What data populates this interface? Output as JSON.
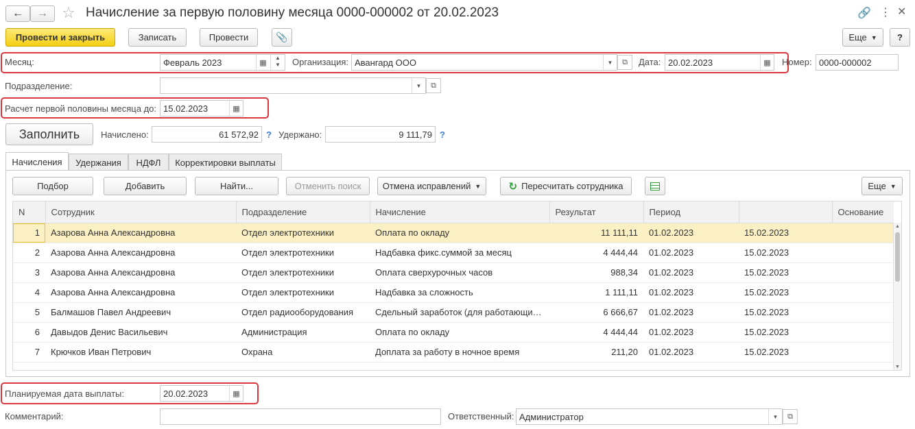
{
  "window": {
    "title": "Начисление за первую половину месяца 0000-000002 от 20.02.2023"
  },
  "toolbar": {
    "post_close": "Провести и закрыть",
    "save": "Записать",
    "post": "Провести",
    "more": "Еще",
    "help": "?"
  },
  "form": {
    "month_label": "Месяц:",
    "month_value": "Февраль 2023",
    "org_label": "Организация:",
    "org_value": "Авангард ООО",
    "date_label": "Дата:",
    "date_value": "20.02.2023",
    "number_label": "Номер:",
    "number_value": "0000-000002",
    "dept_label": "Подразделение:",
    "dept_value": "",
    "calc_label": "Расчет первой половины месяца до:",
    "calc_value": "15.02.2023",
    "fill_button": "Заполнить",
    "accrued_label": "Начислено:",
    "accrued_value": "61 572,92",
    "withheld_label": "Удержано:",
    "withheld_value": "9 111,79",
    "payday_label": "Планируемая дата выплаты:",
    "payday_value": "20.02.2023",
    "comment_label": "Комментарий:",
    "comment_value": "",
    "resp_label": "Ответственный:",
    "resp_value": "Администратор"
  },
  "tabs": [
    "Начисления",
    "Удержания",
    "НДФЛ",
    "Корректировки выплаты"
  ],
  "table_toolbar": {
    "pick": "Подбор",
    "add": "Добавить",
    "find": "Найти...",
    "cancel_search": "Отменить поиск",
    "cancel_corr": "Отмена исправлений",
    "recalc": "Пересчитать сотрудника",
    "more": "Еще"
  },
  "table": {
    "columns": [
      "N",
      "Сотрудник",
      "Подразделение",
      "Начисление",
      "Результат",
      "Период",
      "",
      "Основание"
    ],
    "rows": [
      [
        "1",
        "Азарова Анна Александровна",
        "Отдел электротехники",
        "Оплата по окладу",
        "11 111,11",
        "01.02.2023",
        "15.02.2023",
        ""
      ],
      [
        "2",
        "Азарова Анна Александровна",
        "Отдел электротехники",
        "Надбавка фикс.суммой за месяц",
        "4 444,44",
        "01.02.2023",
        "15.02.2023",
        ""
      ],
      [
        "3",
        "Азарова Анна Александровна",
        "Отдел электротехники",
        "Оплата сверхурочных часов",
        "988,34",
        "01.02.2023",
        "15.02.2023",
        ""
      ],
      [
        "4",
        "Азарова Анна Александровна",
        "Отдел электротехники",
        "Надбавка за сложность",
        "1 111,11",
        "01.02.2023",
        "15.02.2023",
        ""
      ],
      [
        "5",
        "Балмашов Павел Андреевич",
        "Отдел радиооборудования",
        "Сдельный заработок (для работающи…",
        "6 666,67",
        "01.02.2023",
        "15.02.2023",
        ""
      ],
      [
        "6",
        "Давыдов Денис Васильевич",
        "Администрация",
        "Оплата по окладу",
        "4 444,44",
        "01.02.2023",
        "15.02.2023",
        ""
      ],
      [
        "7",
        "Крючков Иван Петрович",
        "Охрана",
        "Доплата за работу в ночное время",
        "211,20",
        "01.02.2023",
        "15.02.2023",
        ""
      ]
    ]
  },
  "colors": {
    "highlight": "#d9363e",
    "primary_button": "#f4cf13",
    "selected_row": "#fbf0c4",
    "help": "#3a7bd5",
    "recalc_icon": "#2e9e3e"
  },
  "icons": [
    "back-arrow-icon",
    "forward-arrow-icon",
    "star-icon",
    "link-icon",
    "more-vertical-icon",
    "close-icon",
    "paperclip-icon",
    "calendar-icon",
    "dropdown-icon",
    "open-icon",
    "refresh-icon",
    "spreadsheet-icon"
  ]
}
